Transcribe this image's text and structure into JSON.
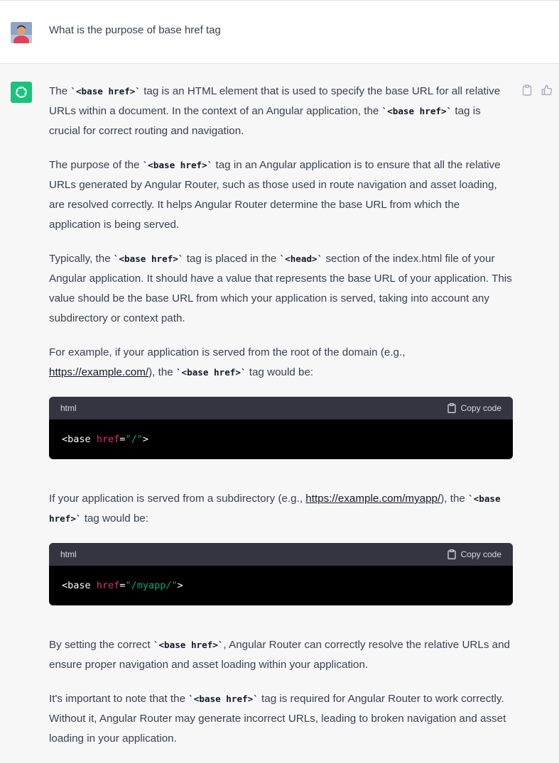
{
  "user": {
    "question": "What is the purpose of base href tag"
  },
  "assistant": {
    "p1": {
      "t1": "The ",
      "c1": "`<base href>`",
      "t2": " tag is an HTML element that is used to specify the base URL for all relative URLs within a document. In the context of an Angular application, the ",
      "c2": "`<base href>`",
      "t3": " tag is crucial for correct routing and navigation."
    },
    "p2": {
      "t1": "The purpose of the ",
      "c1": "`<base href>`",
      "t2": " tag in an Angular application is to ensure that all the relative URLs generated by Angular Router, such as those used in route navigation and asset loading, are resolved correctly. It helps Angular Router determine the base URL from which the application is being served."
    },
    "p3": {
      "t1": "Typically, the ",
      "c1": "`<base href>`",
      "t2": " tag is placed in the ",
      "c2": "`<head>`",
      "t3": " section of the index.html file of your Angular application. It should have a value that represents the base URL of your application. This value should be the base URL from which your application is served, taking into account any subdirectory or context path."
    },
    "p4": {
      "t1": "For example, if your application is served from the root of the domain (e.g., ",
      "link": "https://example.com/",
      "t2": "), the ",
      "c1": "`<base href>`",
      "t3": " tag would be:"
    },
    "code1": {
      "lang": "html",
      "copy_label": "Copy code",
      "tag": "<base ",
      "attr": "href",
      "eq": "=",
      "value": "\"/\"",
      "close": ">"
    },
    "p5": {
      "t1": "If your application is served from a subdirectory (e.g., ",
      "link": "https://example.com/myapp/",
      "t2": "), the ",
      "c1": "`<base href>`",
      "t3": " tag would be:"
    },
    "code2": {
      "lang": "html",
      "copy_label": "Copy code",
      "tag": "<base ",
      "attr": "href",
      "eq": "=",
      "value": "\"/myapp/\"",
      "close": ">"
    },
    "p6": {
      "t1": "By setting the correct ",
      "c1": "`<base href>`",
      "t2": ", Angular Router can correctly resolve the relative URLs and ensure proper navigation and asset loading within your application."
    },
    "p7": {
      "t1": "It's important to note that the ",
      "c1": "`<base href>`",
      "t2": " tag is required for Angular Router to work correctly. Without it, Angular Router may generate incorrect URLs, leading to broken navigation and asset loading in your application."
    }
  },
  "icons": {
    "user_avatar": "user-avatar",
    "bot_avatar": "openai-logo-icon",
    "copy_message": "clipboard-icon",
    "thumbs_up": "thumbs-up-icon",
    "copy_code": "clipboard-icon"
  },
  "colors": {
    "bot_avatar_bg": "#19c37d",
    "code_header_bg": "#343541",
    "code_bg": "#000000",
    "code_attr": "#df3079",
    "code_string": "#00a67d"
  }
}
